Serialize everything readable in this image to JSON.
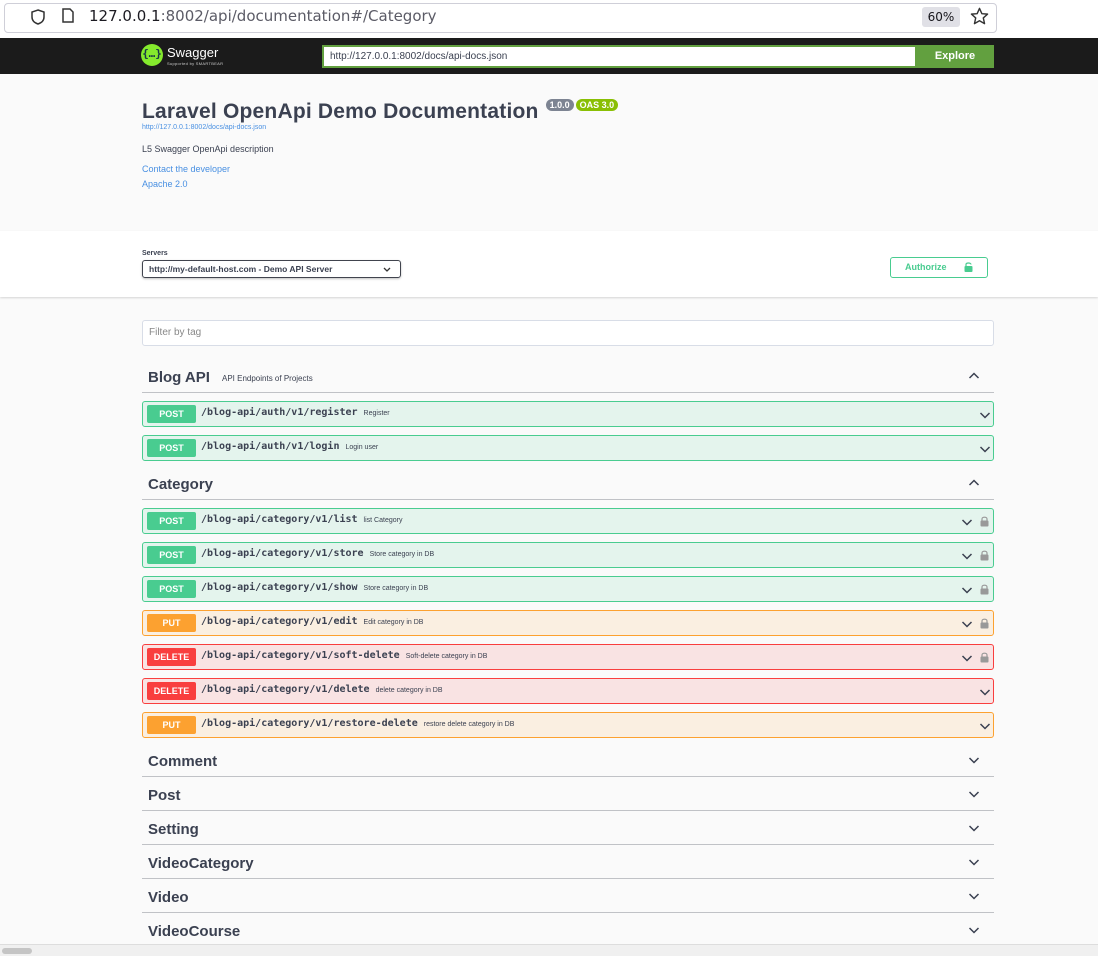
{
  "browser": {
    "url_host": "127.0.0.1",
    "url_rest": ":8002/api/documentation#/Category",
    "zoom": "60%"
  },
  "topbar": {
    "logo_glyph": "{…}",
    "brand": "Swagger",
    "brand_sub": "Supported by SMARTBEAR",
    "spec_url": "http://127.0.0.1:8002/docs/api-docs.json",
    "explore_label": "Explore"
  },
  "info": {
    "title": "Laravel OpenApi Demo Documentation",
    "version": "1.0.0",
    "oas": "OAS 3.0",
    "doc_link": "http://127.0.0.1:8002/docs/api-docs.json",
    "description": "L5 Swagger OpenApi description",
    "contact": "Contact the developer",
    "license": "Apache 2.0"
  },
  "scheme": {
    "servers_label": "Servers",
    "server": "http://my-default-host.com - Demo API Server",
    "authorize": "Authorize"
  },
  "filter": {
    "placeholder": "Filter by tag"
  },
  "tags": [
    {
      "name": "Blog API",
      "description": "API Endpoints of Projects",
      "expanded": true,
      "operations": [
        {
          "method": "POST",
          "path": "/blog-api/auth/v1/register",
          "summary": "Register",
          "locked": false
        },
        {
          "method": "POST",
          "path": "/blog-api/auth/v1/login",
          "summary": "Login user",
          "locked": false
        }
      ]
    },
    {
      "name": "Category",
      "description": "",
      "expanded": true,
      "operations": [
        {
          "method": "POST",
          "path": "/blog-api/category/v1/list",
          "summary": "list Category",
          "locked": true
        },
        {
          "method": "POST",
          "path": "/blog-api/category/v1/store",
          "summary": "Store category in DB",
          "locked": true
        },
        {
          "method": "POST",
          "path": "/blog-api/category/v1/show",
          "summary": "Store category in DB",
          "locked": true
        },
        {
          "method": "PUT",
          "path": "/blog-api/category/v1/edit",
          "summary": "Edit category in DB",
          "locked": true
        },
        {
          "method": "DELETE",
          "path": "/blog-api/category/v1/soft-delete",
          "summary": "Soft-delete category in DB",
          "locked": true
        },
        {
          "method": "DELETE",
          "path": "/blog-api/category/v1/delete",
          "summary": "delete category in DB",
          "locked": false
        },
        {
          "method": "PUT",
          "path": "/blog-api/category/v1/restore-delete",
          "summary": "restore delete category in DB",
          "locked": false
        }
      ]
    },
    {
      "name": "Comment",
      "description": "",
      "expanded": false,
      "operations": []
    },
    {
      "name": "Post",
      "description": "",
      "expanded": false,
      "operations": []
    },
    {
      "name": "Setting",
      "description": "",
      "expanded": false,
      "operations": []
    },
    {
      "name": "VideoCategory",
      "description": "",
      "expanded": false,
      "operations": []
    },
    {
      "name": "Video",
      "description": "",
      "expanded": false,
      "operations": []
    },
    {
      "name": "VideoCourse",
      "description": "",
      "expanded": false,
      "operations": []
    }
  ],
  "colors": {
    "post": "#49cc90",
    "put": "#fca130",
    "delete": "#f93e3e",
    "topbar": "#1b1b1b",
    "explore": "#62a03f",
    "link": "#4990e2"
  }
}
